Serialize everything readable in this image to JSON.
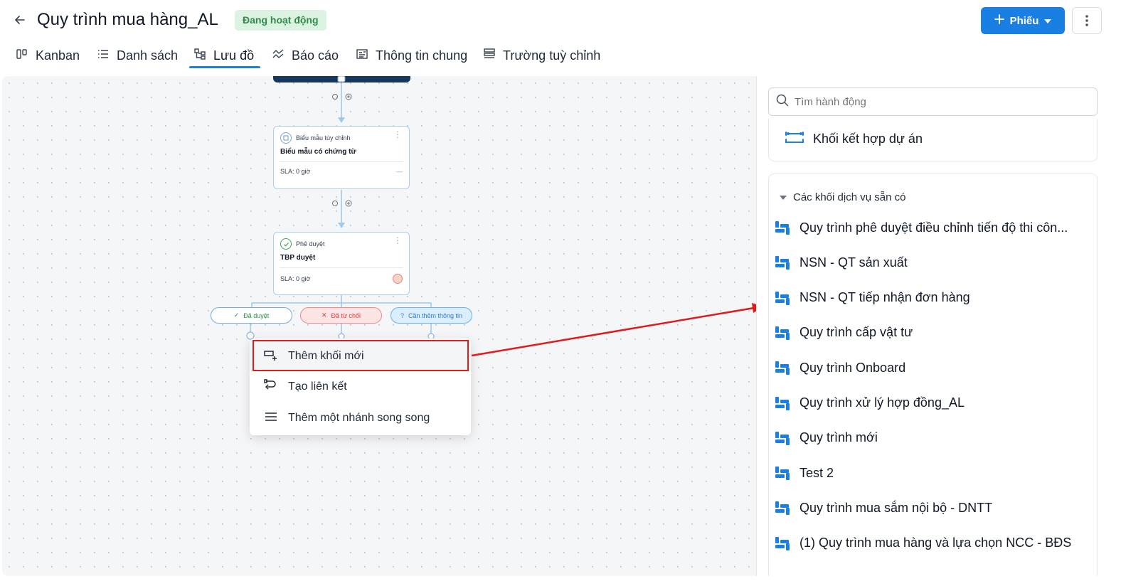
{
  "header": {
    "title": "Quy trình mua hàng_AL",
    "status": "Đang hoạt động",
    "ticket_button": "Phiếu"
  },
  "tabs": [
    {
      "label": "Kanban",
      "icon": "kanban-icon"
    },
    {
      "label": "Danh sách",
      "icon": "list-icon"
    },
    {
      "label": "Lưu đồ",
      "icon": "flowchart-icon",
      "active": true
    },
    {
      "label": "Báo cáo",
      "icon": "chart-icon"
    },
    {
      "label": "Thông tin chung",
      "icon": "info-icon"
    },
    {
      "label": "Trường tuỳ chỉnh",
      "icon": "fields-icon"
    }
  ],
  "flow": {
    "node1": {
      "type": "Biểu mẫu tùy chỉnh",
      "title": "Biểu mẫu có chứng từ",
      "sla": "SLA: 0 giờ",
      "sla_extra": "—"
    },
    "node2": {
      "type": "Phê duyệt",
      "title": "TBP duyệt",
      "sla": "SLA: 0 giờ"
    },
    "branches": [
      "Đã duyệt",
      "Đã từ chối",
      "Cần thêm thông tin"
    ]
  },
  "context_menu": {
    "items": [
      "Thêm khối mới",
      "Tạo liên kết",
      "Thêm một nhánh song song"
    ]
  },
  "panel": {
    "search_placeholder": "Tìm hành động",
    "top_item": "Khối kết hợp dự án",
    "section_title": "Các khối dịch vụ sẵn có",
    "services": [
      "Quy trình phê duyệt điều chỉnh tiến độ thi côn...",
      "NSN - QT sản xuất",
      "NSN - QT tiếp nhận đơn hàng",
      "Quy trình cấp vật tư",
      "Quy trình Onboard",
      "Quy trình xử lý hợp đồng_AL",
      "Quy trình mới",
      "Test 2",
      "Quy trình mua sắm nội bộ - DNTT",
      "(1) Quy trình mua hàng và lựa chọn NCC - BĐS"
    ]
  },
  "colors": {
    "accent": "#1a7fe3",
    "status_bg": "#dcf3e1",
    "status_text": "#2e8b4b",
    "highlight_red": "#e01b1b"
  }
}
